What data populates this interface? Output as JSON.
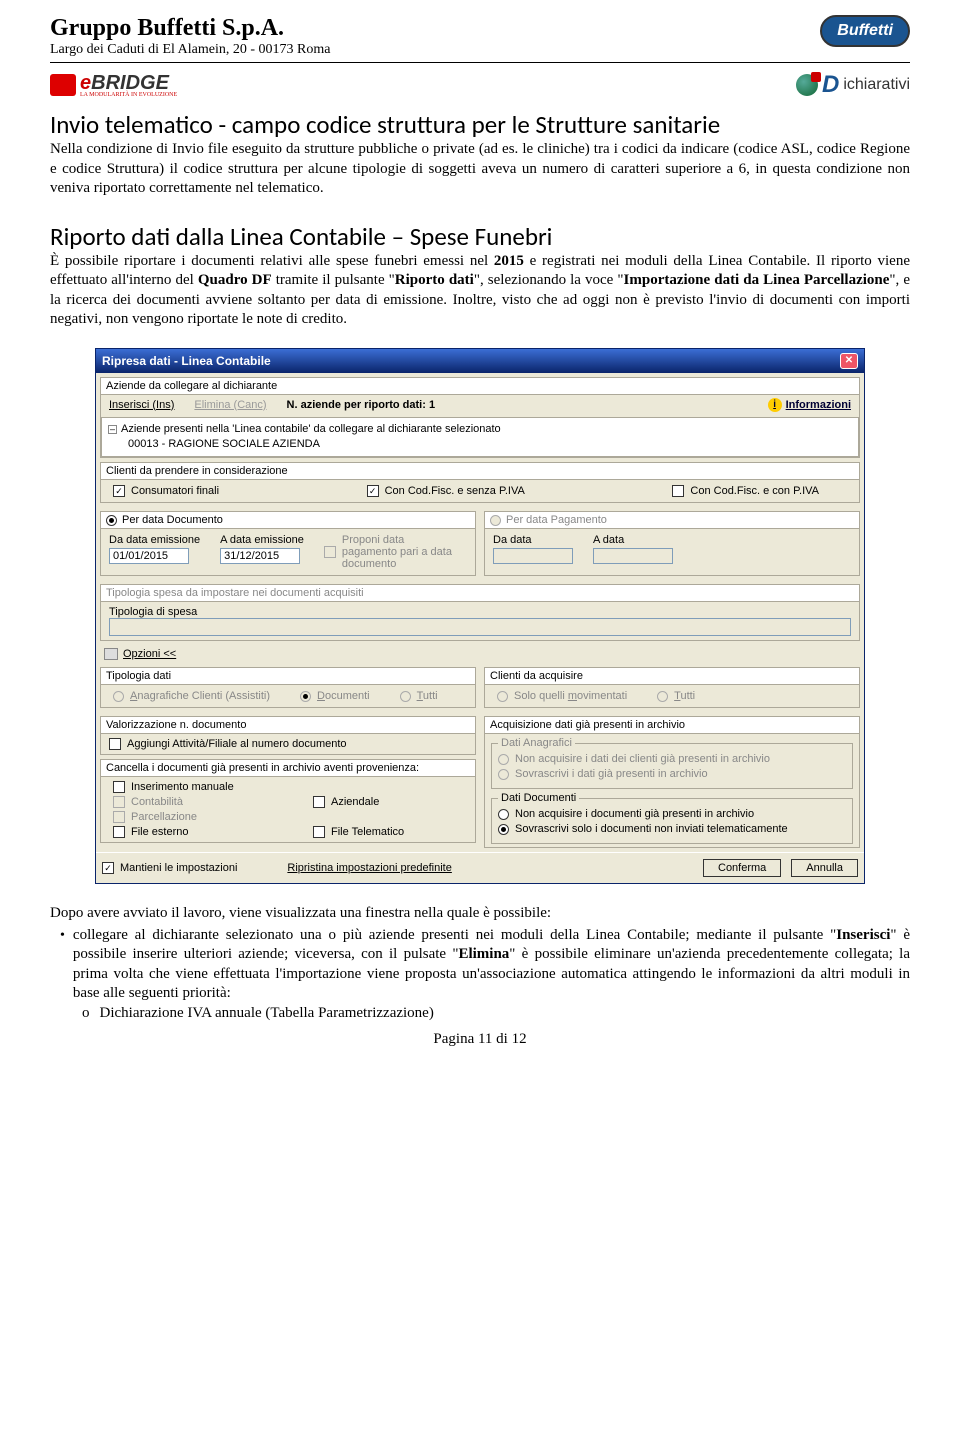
{
  "header": {
    "company": "Gruppo Buffetti S.p.A.",
    "address": "Largo dei Caduti di El Alamein, 20 - 00173 Roma",
    "logo_right": "Buffetti",
    "ebridge_e": "e",
    "ebridge_bridge": "BRIDGE",
    "ebridge_sub": "LA MODULARITÀ IN EVOLUZIONE",
    "dichiarativi_d": "D",
    "dichiarativi_rest": "ichiarativi"
  },
  "section1": {
    "title": "Invio telematico - campo codice struttura per le Strutture sanitarie",
    "body": "Nella condizione di Invio file eseguito da strutture pubbliche o private (ad es. le cliniche) tra i codici da indicare (codice ASL, codice Regione e codice Struttura) il codice struttura per alcune tipologie di soggetti aveva un numero di caratteri superiore a 6, in questa condizione non veniva riportato correttamente nel telematico."
  },
  "section2": {
    "title": "Riporto dati dalla Linea Contabile – Spese Funebri",
    "body_pre": "È possibile riportare i documenti relativi alle spese funebri emessi nel ",
    "year": "2015",
    "body_mid1": " e registrati nei moduli della Linea Contabile. Il riporto viene effettuato all'interno del ",
    "quadro": "Quadro DF",
    "body_mid2": " tramite il pulsante \"",
    "riporto": "Riporto dati",
    "body_mid3": "\", selezionando la voce \"",
    "importazione": "Importazione dati da Linea Parcellazione",
    "body_mid4": "\", e la ricerca dei documenti avviene soltanto per data di emissione. Inoltre, visto che ad oggi non è previsto l'invio di documenti con importi negativi, non vengono riportate le note di credito."
  },
  "dialog": {
    "title": "Ripresa dati - Linea Contabile",
    "grp_aziende": "Aziende da collegare al dichiarante",
    "inserisci": "Inserisci (Ins)",
    "elimina": "Elimina (Canc)",
    "n_aziende": "N. aziende per riporto dati: 1",
    "informazioni": "Informazioni",
    "tree_line1": "Aziende presenti nella 'Linea contabile' da collegare al dichiarante selezionato",
    "tree_line2": "00013 - RAGIONE SOCIALE AZIENDA",
    "grp_clienti": "Clienti da prendere in considerazione",
    "consumatori": "Consumatori finali",
    "concf_nopiva": "Con Cod.Fisc. e senza P.IVA",
    "concf_piva": "Con Cod.Fisc. e con P.IVA",
    "per_data_doc": "Per data Documento",
    "per_data_pag": "Per data Pagamento",
    "da_data_em": "Da data emissione",
    "a_data_em": "A data emissione",
    "da_val": "01/01/2015",
    "a_val": "31/12/2015",
    "proponi": "Proponi data pagamento pari a data documento",
    "da_data": "Da data",
    "a_data": "A data",
    "tipologia_spesa_title": "Tipologia spesa da impostare nei documenti acquisiti",
    "tipologia_spesa_lbl": "Tipologia di spesa",
    "opzioni": "Opzioni <<",
    "tipologia_dati": "Tipologia dati",
    "anag_clienti": "Anagrafiche Clienti (Assistiti)",
    "documenti": "Documenti",
    "tutti": "Tutti",
    "clienti_acquisire": "Clienti da acquisire",
    "solo_mov": "Solo quelli movimentati",
    "valorizzazione": "Valorizzazione n. documento",
    "aggiungi": "Aggiungi Attività/Filiale al numero documento",
    "acquisizione": "Acquisizione dati già presenti in archivio",
    "cancella": "Cancella i documenti già presenti in archivio aventi provenienza:",
    "ins_manuale": "Inserimento manuale",
    "contabilita": "Contabilità",
    "aziendale": "Aziendale",
    "parcellazione": "Parcellazione",
    "file_esterno": "File esterno",
    "file_telematico": "File Telematico",
    "dati_anag": "Dati Anagrafici",
    "non_acq_clienti": "Non acquisire i dati dei clienti già presenti in archivio",
    "sovrascrivi_clienti": "Sovrascrivi i dati già presenti in archivio",
    "dati_doc": "Dati Documenti",
    "non_acq_doc": "Non acquisire i documenti già presenti in archivio",
    "sovrascrivi_doc": "Sovrascrivi solo i documenti non inviati telematicamente",
    "mantieni": "Mantieni le impostazioni",
    "ripristina": "Ripristina impostazioni predefinite",
    "conferma": "Conferma",
    "annulla": "Annulla"
  },
  "after": {
    "intro": "Dopo avere avviato il lavoro, viene visualizzata una finestra nella quale è possibile:",
    "bullet_pre": "collegare al dichiarante selezionato una o più aziende presenti nei moduli della Linea Contabile; mediante il pulsante \"",
    "inserisci": "Inserisci",
    "bullet_mid1": "\" è possibile inserire ulteriori aziende; viceversa, con il pulsate \"",
    "elimina": "Elimina",
    "bullet_mid2": "\" è possibile eliminare un'azienda precedentemente collegata; la prima volta che viene effettuata l'importazione viene proposta un'associazione automatica attingendo le informazioni da altri moduli in base alle seguenti priorità:",
    "sub_o": "Dichiarazione IVA annuale (Tabella Parametrizzazione)"
  },
  "footer": "Pagina 11 di 12"
}
